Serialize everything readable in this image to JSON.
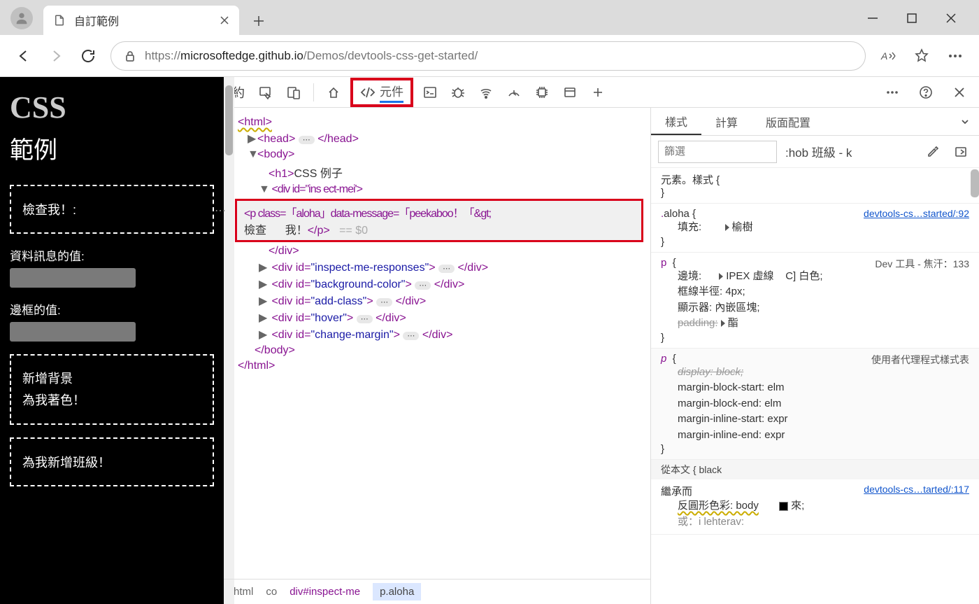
{
  "browser": {
    "tab_title": "自訂範例",
    "url_prefix": "https://",
    "url_host": "microsoftedge.github.io",
    "url_path": "/Demos/devtools-css-get-started/"
  },
  "page": {
    "h1": "CSS",
    "h2": "範例",
    "inspect_label": "檢查我！:",
    "data_msg_label": "資料訊息的值:",
    "border_label": "邊框的值:",
    "bg_line1": "新增背景",
    "bg_line2": "為我著色！",
    "addclass": "為我新增班級！"
  },
  "devtools": {
    "toolbar_text": "約",
    "elements_tab": "元件",
    "styles_tabs": {
      "styles": "樣式",
      "computed": "計算",
      "layout": "版面配置"
    },
    "filter_placeholder": "篩選",
    "hob": ":hob 班級 - k",
    "breadcrumb": {
      "html": "html",
      "body": "co",
      "div": "div#inspect-me",
      "p": "p.aloha"
    }
  },
  "dom": {
    "html_open": "<html>",
    "head": "<head>",
    "head_close": "</head>",
    "body_open": "<body>",
    "h1_open": "<h1>",
    "h1_text": "CSS 例子",
    "div_inspect": "<div id=\"ins ect-mei'>",
    "p_line1": "<p  class=「aloha」data-message=「peekaboo！「&gt;",
    "p_line2_a": "檢查",
    "p_line2_b": "我！",
    "p_close": "</p>",
    "eq0": "== $0",
    "div_close": "</div>",
    "div_responses_a": "<div  id=",
    "div_responses_v": "\"inspect-me-responses\"",
    "div_responses_b": ">",
    "div_end": "</div>",
    "div_bg_v": "\"background-color\"",
    "div_addclass_v": "\"add-class\"",
    "div_hover_v": "\"hover\"",
    "div_margin_v": "\"change-margin\"",
    "body_close": "</body>",
    "html_close": "</html>"
  },
  "styles": {
    "element_style": "元素。樣式 {",
    "aloha_sel": ".",
    "aloha_name": "aloha",
    "aloha_brace": " {",
    "aloha_src": "devtools-cs…started/:92",
    "aloha_fill": "填充:",
    "aloha_elm": "榆樹",
    "p_sel": "p",
    "p_src": "Dev 工具 - 焦汗：133",
    "p_border": "邊境:",
    "p_border_v1": "IPEX 虛線",
    "p_border_v2": "C] 白色;",
    "p_radius": "框線半徑: 4px;",
    "p_display": "顯示器: 內嵌區塊;",
    "p_padding": "padding:",
    "p_padding_v": "酯",
    "ua_src": "使用者代理程式樣式表",
    "ua_display": "display: block;",
    "ua_mbs": "margin-block-start: elm",
    "ua_mbe": "margin-block-end: elm",
    "ua_mis": "margin-inline-start: expr",
    "ua_mie": "margin-inline-end: expr",
    "inherit_body": "從本文 { black",
    "inherit_from": "繼承而",
    "inherit_src": "devtools-cs…tarted/:117",
    "inherit_shape": "反圓形色彩: body",
    "inherit_or": "或：i           lehterav:",
    "inherit_come": "來;"
  }
}
